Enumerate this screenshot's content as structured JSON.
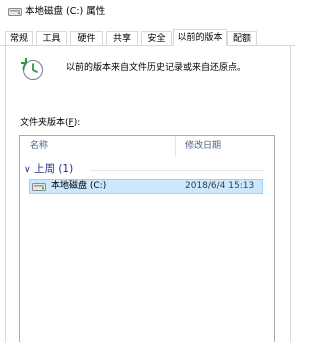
{
  "window": {
    "title": "本地磁盘 (C:) 属性"
  },
  "tabs": [
    {
      "label": "常规",
      "active": false
    },
    {
      "label": "工具",
      "active": false
    },
    {
      "label": "硬件",
      "active": false
    },
    {
      "label": "共享",
      "active": false
    },
    {
      "label": "安全",
      "active": false
    },
    {
      "label": "以前的版本",
      "active": true
    },
    {
      "label": "配额",
      "active": false
    }
  ],
  "header": {
    "icon": "restore-history-icon",
    "text": "以前的版本来自文件历史记录或来自还原点。"
  },
  "versions": {
    "label_prefix": "文件夹版本(",
    "label_hotkey": "F",
    "label_suffix": "):",
    "columns": {
      "name": "名称",
      "date": "修改日期"
    },
    "groups": [
      {
        "label": "上周 (1)",
        "items": [
          {
            "name": "本地磁盘 (C:)",
            "date": "2018/6/4 15:13",
            "icon": "drive-icon",
            "selected": true
          }
        ]
      }
    ]
  },
  "colors": {
    "selection_bg": "#cce8ff",
    "selection_border": "#99d1ff",
    "group_text": "#1e3287",
    "column_header_text": "#4d6082"
  }
}
